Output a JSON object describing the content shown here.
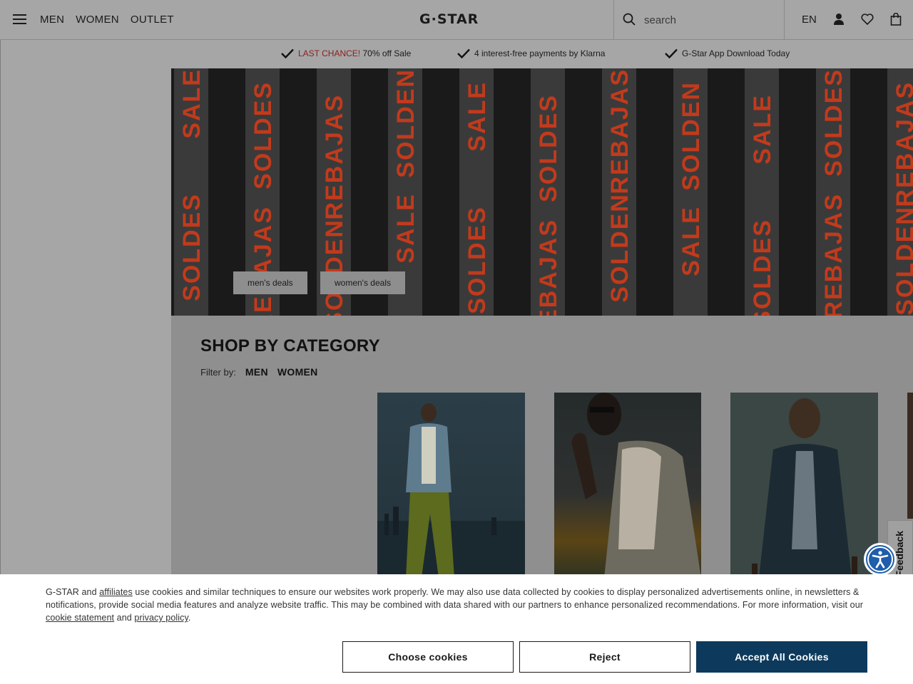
{
  "header": {
    "nav": [
      "MEN",
      "WOMEN",
      "OUTLET"
    ],
    "logo": "G·STAR",
    "search_placeholder": "search",
    "language": "EN"
  },
  "usp": {
    "item1_highlight": "LAST CHANCE!",
    "item1_rest": "70% off Sale",
    "item2": "4 interest-free payments by Klarna",
    "item3": "G-Star App Download Today"
  },
  "hero": {
    "words": [
      "SALE",
      "SOLDES",
      "REBAJAS",
      "SOLDEN"
    ],
    "buttons": [
      "men's deals",
      "women's deals"
    ]
  },
  "category": {
    "title": "SHOP BY CATEGORY",
    "filter_label": "Filter by:",
    "filters": [
      "MEN",
      "WOMEN"
    ]
  },
  "feedback_label": "Feedback",
  "cookie": {
    "t1": "G-STAR and ",
    "link_affiliates": "affiliates",
    "t2": " use cookies and similar techniques to ensure our websites work properly. We may also use data collected by cookies to display personalized advertisements online, in newsletters & notifications, provide social media features and analyze website traffic. This may be combined with data shared with our partners to enhance personalized recommendations. For more information, visit our ",
    "link_cookie_statement": "cookie statement",
    "t3": " and ",
    "link_privacy": "privacy policy",
    "t4": ".",
    "choose_label": "Choose cookies",
    "reject_label": "Reject",
    "accept_label": "Accept All Cookies"
  },
  "colors": {
    "accept_button": "#0d3a5c",
    "sale_text": "#c23a1c",
    "usp_highlight": "#8b1f1f",
    "accessibility": "#1e5eaa"
  }
}
